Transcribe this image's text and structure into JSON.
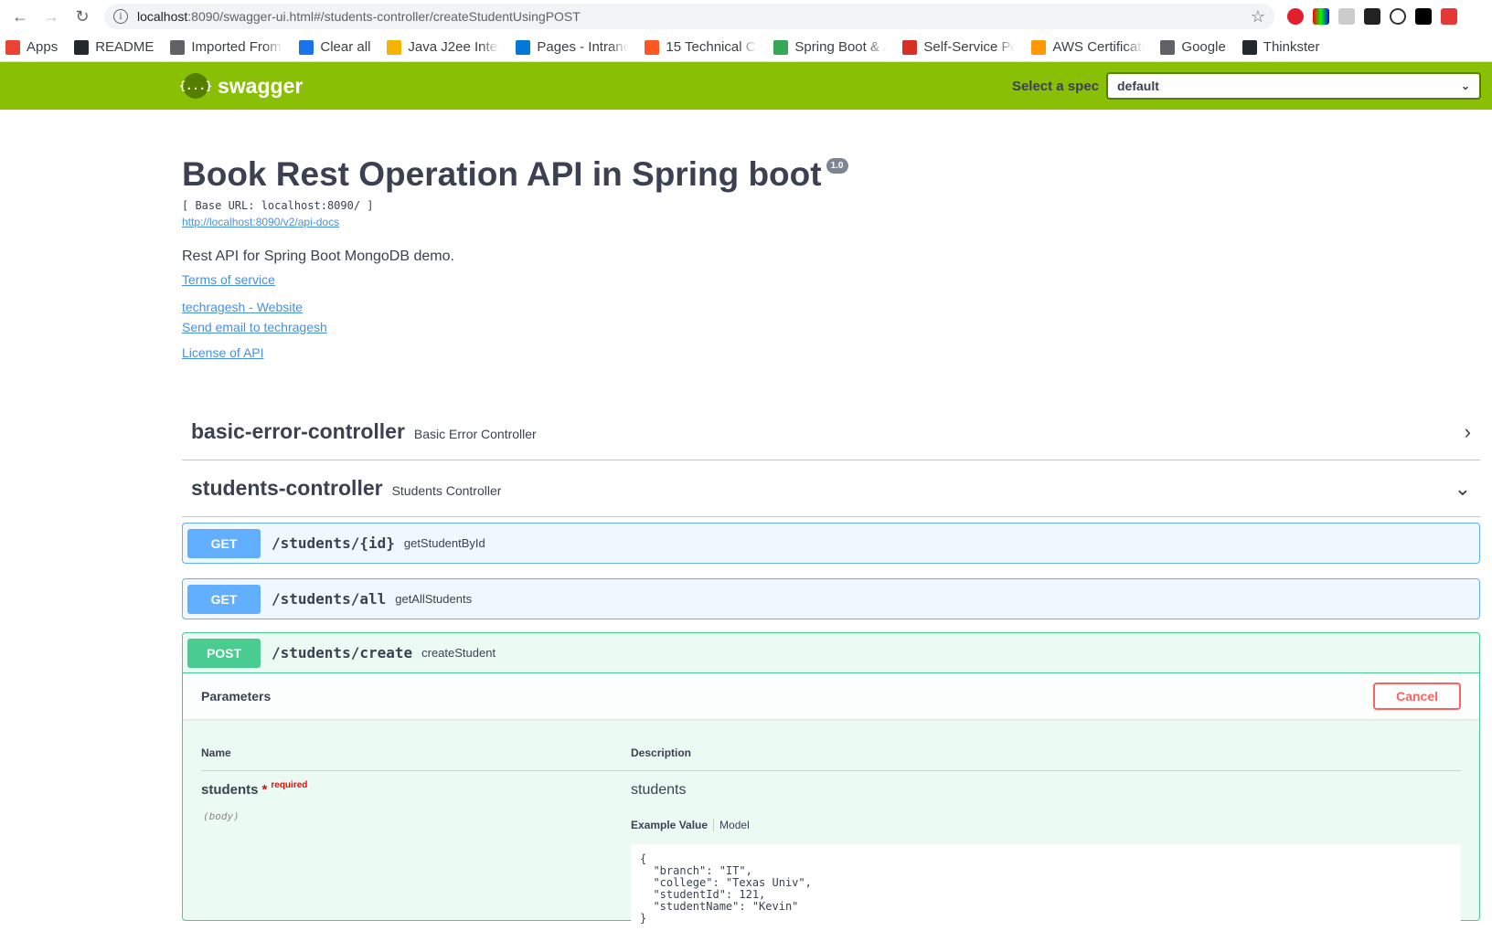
{
  "browser": {
    "url_host": "localhost",
    "url_rest": ":8090/swagger-ui.html#/students-controller/createStudentUsingPOST",
    "bookmarks": [
      {
        "label": "Apps",
        "color": "#ea4335"
      },
      {
        "label": "README",
        "color": "#24292e"
      },
      {
        "label": "Imported From I",
        "color": "#5f6368"
      },
      {
        "label": "Clear all",
        "color": "#1a73e8"
      },
      {
        "label": "Java J2ee Interv",
        "color": "#f4b400"
      },
      {
        "label": "Pages - Intranet",
        "color": "#0078d4"
      },
      {
        "label": "15 Technical Cor",
        "color": "#ff5722"
      },
      {
        "label": "Spring Boot & A",
        "color": "#34a853"
      },
      {
        "label": "Self-Service Port",
        "color": "#d93025"
      },
      {
        "label": "AWS Certificatio",
        "color": "#ff9900"
      },
      {
        "label": "Google",
        "color": "#5f6368"
      },
      {
        "label": "Thinkster",
        "color": "#24292e"
      }
    ]
  },
  "topbar": {
    "logo_text": "swagger",
    "logo_icon": "{...}",
    "spec_label": "Select a spec",
    "spec_value": "default"
  },
  "info": {
    "title": "Book Rest Operation API in Spring boot",
    "version": "1.0",
    "base_url": "[ Base URL: localhost:8090/ ]",
    "api_docs": "http://localhost:8090/v2/api-docs",
    "description": "Rest API for Spring Boot MongoDB demo.",
    "terms": "Terms of service",
    "website": "techragesh - Website",
    "email": "Send email to techragesh",
    "license": "License of API"
  },
  "tags": [
    {
      "name": "basic-error-controller",
      "desc": "Basic Error Controller"
    },
    {
      "name": "students-controller",
      "desc": "Students Controller"
    }
  ],
  "operations": [
    {
      "method": "GET",
      "path": "/students/{id}",
      "summary": "getStudentById"
    },
    {
      "method": "GET",
      "path": "/students/all",
      "summary": "getAllStudents"
    },
    {
      "method": "POST",
      "path": "/students/create",
      "summary": "createStudent"
    }
  ],
  "params": {
    "title": "Parameters",
    "cancel": "Cancel",
    "col_name": "Name",
    "col_desc": "Description",
    "param_name": "students",
    "star": "*",
    "required": "required",
    "param_in": "(body)",
    "param_desc": "students",
    "tab_example": "Example Value",
    "tab_model": "Model",
    "example_lines": [
      "{",
      "  \"branch\": \"IT\",",
      "  \"college\": \"Texas Univ\",",
      "  \"studentId\": 121,",
      "  \"studentName\": \"Kevin\"",
      "}"
    ]
  }
}
